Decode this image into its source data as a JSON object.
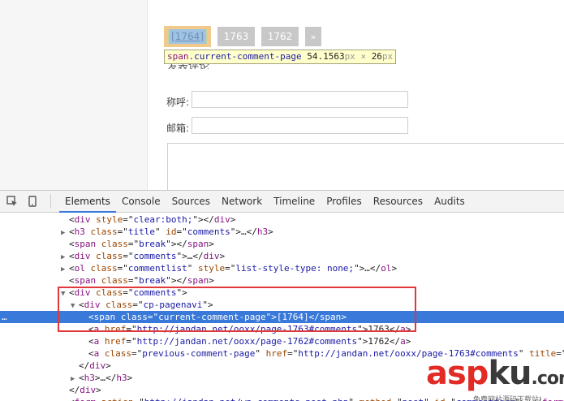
{
  "page": {
    "pagination": {
      "current": "[1764]",
      "pages": [
        "1763",
        "1762"
      ],
      "next": "»"
    },
    "tooltip": {
      "tag": "span",
      "class_name": ".current-comment-page",
      "size": "54.1563",
      "unit1": "px",
      "times": "×",
      "height": "26",
      "unit2": "px"
    },
    "form_title": "发表评论",
    "name_label": "称呼:",
    "email_label": "邮箱:"
  },
  "devtools": {
    "tabs": [
      "Elements",
      "Console",
      "Sources",
      "Network",
      "Timeline",
      "Profiles",
      "Resources",
      "Audits"
    ],
    "active_tab": "Elements",
    "lines": [
      {
        "indent": 0,
        "tri": "",
        "html": [
          "<",
          "div",
          " ",
          "style",
          "=\"",
          "clear:both;",
          "\"",
          "></",
          "div",
          ">"
        ]
      },
      {
        "indent": 0,
        "tri": "▶",
        "html": [
          "<",
          "h3",
          " ",
          "class",
          "=\"",
          "title",
          "\"",
          " ",
          "id",
          "=\"",
          "comments",
          "\"",
          ">…</",
          "h3",
          ">"
        ]
      },
      {
        "indent": 0,
        "tri": "",
        "html": [
          "<",
          "span",
          " ",
          "class",
          "=\"",
          "break",
          "\"",
          "></",
          "span",
          ">"
        ]
      },
      {
        "indent": 0,
        "tri": "▶",
        "html": [
          "<",
          "div",
          " ",
          "class",
          "=\"",
          "comments",
          "\"",
          ">…</",
          "div",
          ">"
        ]
      },
      {
        "indent": 0,
        "tri": "▶",
        "html": [
          "<",
          "ol",
          " ",
          "class",
          "=\"",
          "commentlist",
          "\"",
          " ",
          "style",
          "=\"",
          "list-style-type: none;",
          "\"",
          ">…</",
          "ol",
          ">"
        ]
      },
      {
        "indent": 0,
        "tri": "",
        "html": [
          "<",
          "span",
          " ",
          "class",
          "=\"",
          "break",
          "\"",
          "></",
          "span",
          ">"
        ]
      },
      {
        "indent": 0,
        "tri": "▼",
        "html": [
          "<",
          "div",
          " ",
          "class",
          "=\"",
          "comments",
          "\"",
          ">"
        ]
      },
      {
        "indent": 1,
        "tri": "▼",
        "html": [
          "<",
          "div",
          " ",
          "class",
          "=\"",
          "cp-pagenavi",
          "\"",
          ">"
        ]
      },
      {
        "indent": 2,
        "tri": "",
        "selected": true,
        "html": [
          "<",
          "span",
          " ",
          "class",
          "=\"",
          "current-comment-page",
          "\"",
          ">[1764]</",
          "span",
          ">"
        ]
      },
      {
        "indent": 2,
        "tri": "",
        "html": [
          "<",
          "a",
          " ",
          "href",
          "=\"",
          "http://jandan.net/ooxx/page-1763#comments",
          "\"",
          ">1763</",
          "a",
          ">"
        ]
      },
      {
        "indent": 2,
        "tri": "",
        "html": [
          "<",
          "a",
          " ",
          "href",
          "=\"",
          "http://jandan.net/ooxx/page-1762#comments",
          "\"",
          ">1762</",
          "a",
          ">"
        ]
      },
      {
        "indent": 2,
        "tri": "",
        "html": [
          "<",
          "a",
          " ",
          "class",
          "=\"",
          "previous-comment-page",
          "\"",
          " ",
          "href",
          "=\"",
          "http://jandan.net/ooxx/page-1763#comments",
          "\"",
          " ",
          "title",
          "=\""
        ]
      },
      {
        "indent": 1,
        "tri": "",
        "html": [
          "</",
          "div",
          ">"
        ]
      },
      {
        "indent": 1,
        "tri": "▶",
        "html": [
          "<",
          "h3",
          ">…</",
          "h3",
          ">"
        ]
      },
      {
        "indent": 0,
        "tri": "",
        "html": [
          "</",
          "div",
          ">"
        ]
      },
      {
        "indent": 0,
        "tri": "▶",
        "html": [
          "<",
          "form",
          " ",
          "action",
          "=\"",
          "http://jandan.net/wp-comments-post.php",
          "\"",
          " ",
          "method",
          "=\"",
          "post",
          "\"",
          " ",
          "id",
          "=\"",
          "commentform",
          "\"",
          ">…</",
          "form",
          ">"
        ]
      }
    ],
    "selected_marker": "…"
  },
  "watermark": {
    "text_a": "asp",
    "text_k": "ku",
    "text_tail": ".com",
    "sub": "免费网站源码下载站!"
  }
}
